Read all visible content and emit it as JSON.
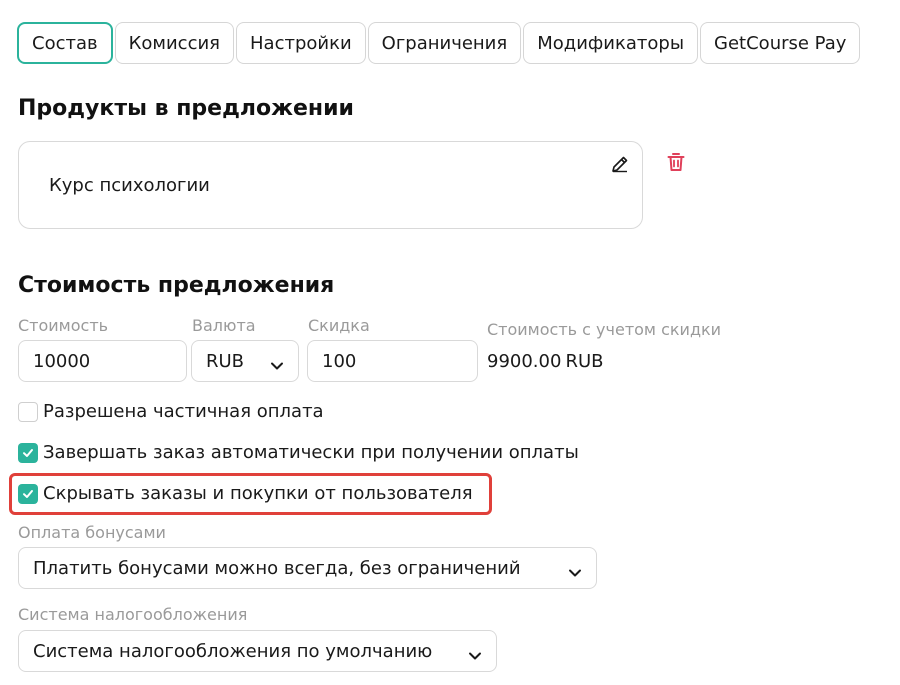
{
  "tabs": [
    {
      "label": "Состав",
      "active": true
    },
    {
      "label": "Комиссия"
    },
    {
      "label": "Настройки"
    },
    {
      "label": "Ограничения"
    },
    {
      "label": "Модификаторы"
    },
    {
      "label": "GetCourse Pay"
    }
  ],
  "products": {
    "title": "Продукты в предложении",
    "items": [
      {
        "name": "Курс психологии"
      }
    ]
  },
  "pricing": {
    "title": "Стоимость предложения",
    "price_label": "Стоимость",
    "price_value": "10000",
    "currency_label": "Валюта",
    "currency_value": "RUB",
    "discount_label": "Скидка",
    "discount_value": "100",
    "total_label": "Стоимость с учетом скидки",
    "total_value": "9900.00",
    "total_currency": "RUB"
  },
  "options": [
    {
      "label": "Разрешена частичная оплата",
      "checked": false
    },
    {
      "label": "Завершать заказ автоматически при получении оплаты",
      "checked": true
    },
    {
      "label": "Скрывать заказы и покупки от пользователя",
      "checked": true
    }
  ],
  "bonus": {
    "label": "Оплата бонусами",
    "value": "Платить бонусами можно всегда, без ограничений"
  },
  "tax": {
    "label": "Система налогообложения",
    "value": "Система налогообложения по умолчанию"
  },
  "colors": {
    "accent": "#2bb39c",
    "highlight": "#e0403a",
    "delete": "#e0405a"
  }
}
